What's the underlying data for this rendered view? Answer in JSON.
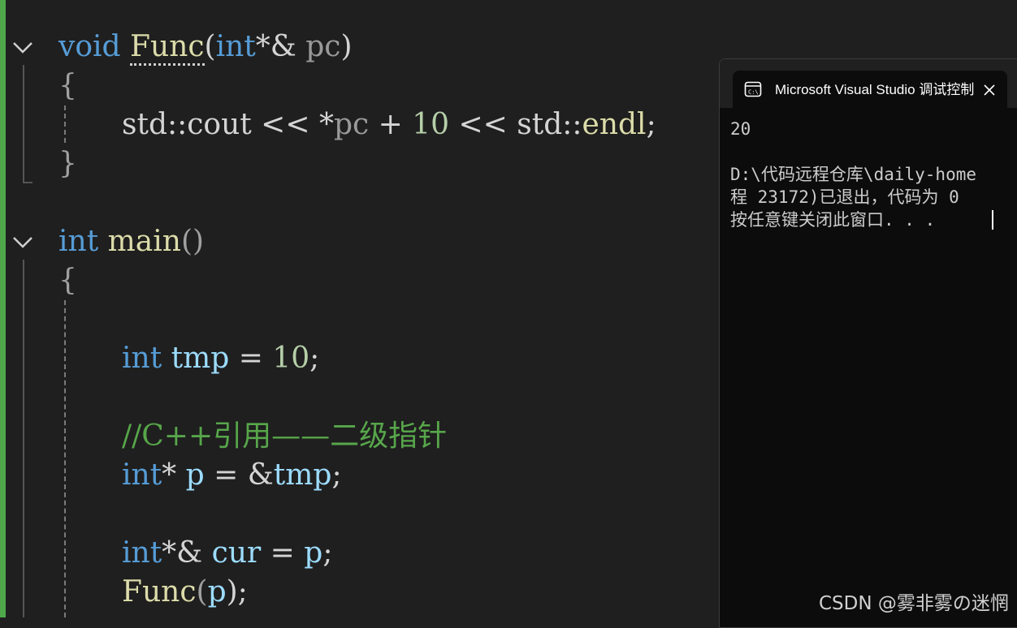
{
  "editor": {
    "lines": {
      "l1": {
        "kw_void": "void",
        "fn_name": "Func",
        "open_paren": "(",
        "kw_int": "int",
        "ref_ptr": "*&",
        "space": " ",
        "param": "pc",
        "close_paren": ")"
      },
      "l2": {
        "brace": "{"
      },
      "l3": {
        "indent": "",
        "ns1": "std::cout",
        "op1": " << ",
        "star": "*",
        "var": "pc",
        "op2": " + ",
        "num": "10",
        "op3": " << ",
        "ns2": "std::",
        "endl": "endl",
        "semi": ";"
      },
      "l4": {
        "brace": "}"
      },
      "l5": {
        "kw_int": "int",
        "space": " ",
        "fn": "main",
        "parens": "()"
      },
      "l6": {
        "brace": "{"
      },
      "l7": {
        "kw_int": "int",
        "space": " ",
        "var": "tmp",
        "op": " = ",
        "num": "10",
        "semi": ";"
      },
      "l8": {
        "comment": "//C++引用——二级指针"
      },
      "l9": {
        "kw_int": "int",
        "star": "* ",
        "var": "p",
        "op": " = &",
        "var2": "tmp",
        "semi": ";"
      },
      "l10": {
        "kw_int": "int",
        "ref": "*& ",
        "var": "cur",
        "op": " = ",
        "var2": "p",
        "semi": ";"
      },
      "l11": {
        "fn": "Func",
        "open": "(",
        "var": "p",
        "close": ");"
      }
    }
  },
  "console": {
    "tab_title": "Microsoft Visual Studio 调试控制台",
    "icon": "terminal-icon",
    "close_icon": "close-icon",
    "output": {
      "line1": "20",
      "line2": "D:\\代码远程仓库\\daily-home",
      "line3": "程 23172)已退出，代码为 0",
      "line4": "按任意键关闭此窗口. . ."
    }
  },
  "watermark": "CSDN @雾非雾の迷惘",
  "colors": {
    "keyword": "#569cd6",
    "function": "#dcdcaa",
    "variable": "#9cdcfe",
    "number": "#b5cea8",
    "comment": "#57a64a",
    "change_bar": "#4ea84b",
    "editor_bg": "#1f1f1f",
    "console_bg": "#0c0c0c"
  }
}
